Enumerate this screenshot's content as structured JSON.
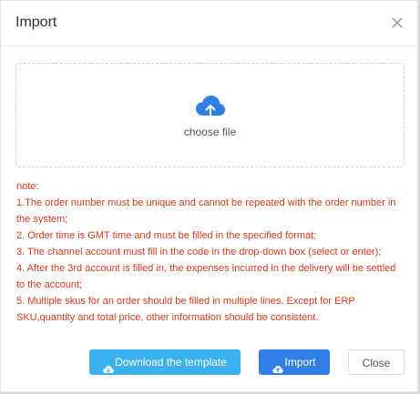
{
  "dialog": {
    "title": "Import",
    "close_icon": "close-icon"
  },
  "upload": {
    "icon": "cloud-upload-icon",
    "label": "choose file",
    "icon_color": "#2f7fe6"
  },
  "notes": {
    "lines": [
      "note:",
      "1.The order number must be unique and cannot be repeated with the order number in the system;",
      "2. Order time is GMT time and must be filled in the specified format;",
      "3. The channel account must fill in the code in the drop-down box (select or enter);",
      "4. After the 3rd account is filled in, the expenses incurred in the delivery will be settled to the account;",
      "5. Multiple skus for an order should be filled in multiple lines. Except for ERP SKU,quantity and total price, other information should be consistent."
    ],
    "color": "#d63a1a"
  },
  "footer": {
    "download_label": "Download the template",
    "download_icon": "cloud-download-icon",
    "import_label": "Import",
    "import_icon": "cloud-upload-icon",
    "close_label": "Close"
  }
}
